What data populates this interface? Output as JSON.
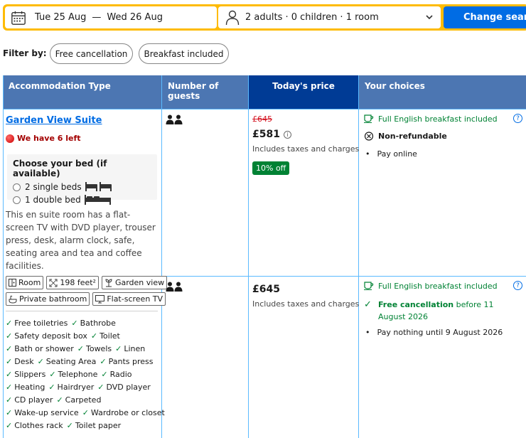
{
  "search": {
    "checkin": "Tue 25 Aug",
    "separator": "—",
    "checkout": "Wed 26 Aug",
    "occupancy": "2 adults · 0 children · 1 room",
    "button": "Change search"
  },
  "filter": {
    "label": "Filter by:",
    "chips": [
      "Free cancellation",
      "Breakfast included"
    ]
  },
  "table": {
    "headers": [
      "Accommodation Type",
      "Number of guests",
      "Today's price",
      "Your choices"
    ]
  },
  "room": {
    "title": "Garden View Suite",
    "scarcity": "We have 6 left",
    "bed_heading": "Choose your bed (if available)",
    "bed_options": [
      "2 single beds",
      "1 double bed"
    ],
    "description": "This en suite room has a flat-screen TV with DVD player, trouser press, desk, alarm clock, safe, seating area and tea and coffee facilities.",
    "features_row1": [
      "Room",
      "198 feet²",
      "Garden view"
    ],
    "features_row2": [
      "Private bathroom",
      "Flat-screen TV"
    ],
    "amenities": [
      [
        "Free toiletries",
        "Bathrobe"
      ],
      [
        "Safety deposit box",
        "Toilet"
      ],
      [
        "Bath or shower",
        "Towels",
        "Linen"
      ],
      [
        "Desk",
        "Seating Area",
        "Pants press"
      ],
      [
        "Slippers",
        "Telephone",
        "Radio"
      ],
      [
        "Heating",
        "Hairdryer",
        "DVD player"
      ],
      [
        "CD player",
        "Carpeted"
      ],
      [
        "Wake-up service",
        "Wardrobe or closet"
      ],
      [
        "Clothes rack",
        "Toilet paper"
      ]
    ]
  },
  "options": [
    {
      "old_price": "£645",
      "price": "£581",
      "taxes": "Includes taxes and charges",
      "discount": "10% off",
      "breakfast": "Full English breakfast included",
      "cancellation": "Non-refundable",
      "payment": "Pay online"
    },
    {
      "price": "£645",
      "taxes": "Includes taxes and charges",
      "breakfast": "Full English breakfast included",
      "cancellation_bold": "Free cancellation",
      "cancellation_rest": " before 11 August 2026",
      "payment": "Pay nothing until 9 August 2026"
    }
  ],
  "colors": {
    "accent_yellow": "#febb02",
    "button_blue": "#006ce4",
    "header_blue": "#4c76b2",
    "header_dark": "#003b95",
    "green": "#008234",
    "red": "#d4111e"
  }
}
